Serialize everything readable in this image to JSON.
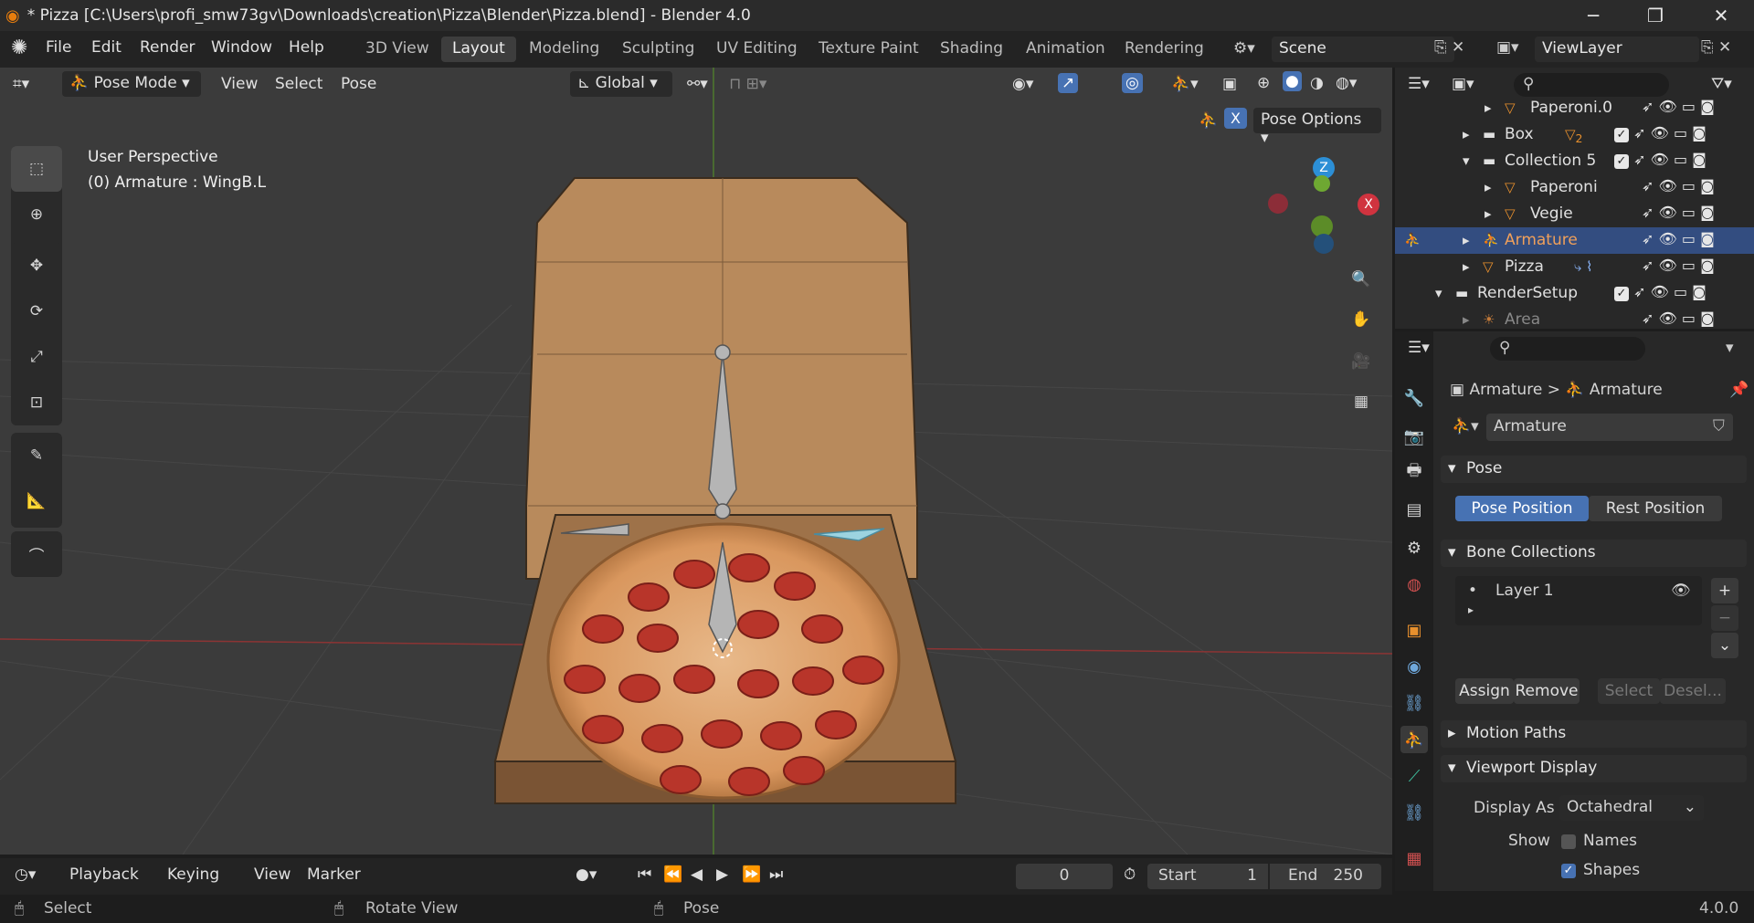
{
  "window": {
    "title": "* Pizza [C:\\Users\\profi_smw73gv\\Downloads\\creation\\Pizza\\Blender\\Pizza.blend] - Blender 4.0"
  },
  "menu": {
    "items": [
      "File",
      "Edit",
      "Render",
      "Window",
      "Help"
    ],
    "workspaces": [
      "3D View",
      "Layout",
      "Modeling",
      "Sculpting",
      "UV Editing",
      "Texture Paint",
      "Shading",
      "Animation",
      "Rendering"
    ],
    "active_workspace": "Layout",
    "scene": "Scene",
    "view_layer": "ViewLayer"
  },
  "viewport_header": {
    "mode": "Pose Mode",
    "menus": [
      "View",
      "Select",
      "Pose"
    ],
    "orientation": "Global",
    "pose_options": "Pose Options",
    "x_mirror": "X"
  },
  "viewport": {
    "view_name": "User Perspective",
    "active_info": "(0) Armature : WingB.L",
    "gizmo": {
      "z": "Z",
      "x": "X"
    }
  },
  "outliner": {
    "rows": [
      {
        "label": "Paperoni.0"
      },
      {
        "label": "Box"
      },
      {
        "label": "Collection 5"
      },
      {
        "label": "Paperoni"
      },
      {
        "label": "Vegie"
      },
      {
        "label": "Armature"
      },
      {
        "label": "Pizza"
      },
      {
        "label": "RenderSetup"
      },
      {
        "label": "Area"
      }
    ],
    "box_badge": "2"
  },
  "properties": {
    "breadcrumb": [
      "Armature",
      "Armature"
    ],
    "data_name": "Armature",
    "pose_panel": "Pose",
    "pose_position": "Pose Position",
    "rest_position": "Rest Position",
    "bone_collections_panel": "Bone Collections",
    "layer_name": "Layer 1",
    "assign": "Assign",
    "remove": "Remove",
    "select": "Select",
    "deselect": "Desel...",
    "motion_paths_panel": "Motion Paths",
    "viewport_display_panel": "Viewport Display",
    "display_as_label": "Display As",
    "display_as_value": "Octahedral",
    "show_label": "Show",
    "names_label": "Names",
    "shapes_label": "Shapes"
  },
  "timeline": {
    "menus": [
      "Playback",
      "Keying",
      "View",
      "Marker"
    ],
    "current_frame": "0",
    "start_label": "Start",
    "start_value": "1",
    "end_label": "End",
    "end_value": "250"
  },
  "status": {
    "left": "Select",
    "middle": "Rotate View",
    "right": "Pose",
    "version": "4.0.0"
  },
  "colors": {
    "accent": "#4772b3",
    "selection_row": "#334d80",
    "x_axis": "#d0333f",
    "y_axis": "#6ea832",
    "z_axis": "#2c8fd6"
  }
}
